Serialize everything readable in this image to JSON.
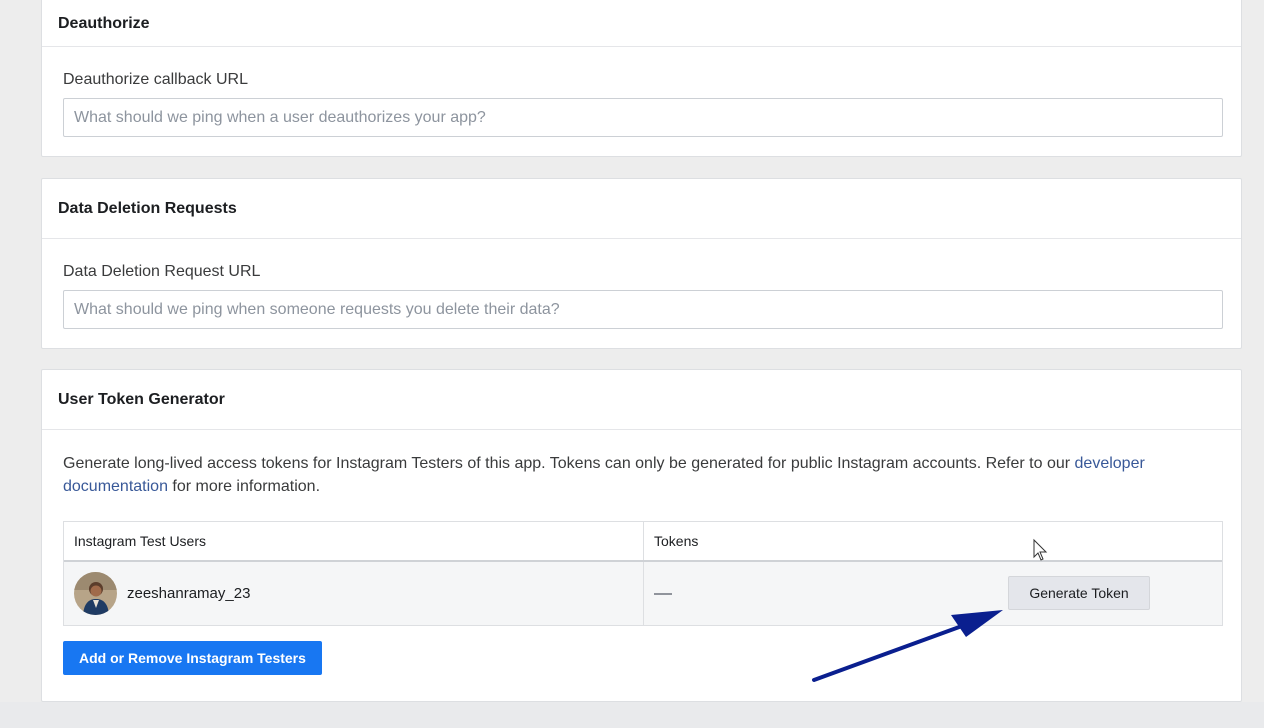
{
  "deauthorize": {
    "title": "Deauthorize",
    "field_label": "Deauthorize callback URL",
    "placeholder": "What should we ping when a user deauthorizes your app?",
    "value": ""
  },
  "data_deletion": {
    "title": "Data Deletion Requests",
    "field_label": "Data Deletion Request URL",
    "placeholder": "What should we ping when someone requests you delete their data?",
    "value": ""
  },
  "token_generator": {
    "title": "User Token Generator",
    "description_before_link": "Generate long-lived access tokens for Instagram Testers of this app. Tokens can only be generated for public Instagram accounts. Refer to our ",
    "link_text": "developer documentation",
    "description_after_link": " for more information.",
    "table": {
      "headers": [
        "Instagram Test Users",
        "Tokens"
      ],
      "rows": [
        {
          "username": "zeeshanramay_23",
          "token": "",
          "action_label": "Generate Token"
        }
      ]
    },
    "add_button_label": "Add or Remove Instagram Testers"
  },
  "colors": {
    "primary_button": "#1877f2",
    "link": "#385898",
    "annotation_arrow": "#0a1f8f"
  },
  "icons": {
    "avatar": "user-avatar-photo",
    "cursor": "mouse-pointer-icon",
    "arrow": "annotation-arrow-icon"
  }
}
